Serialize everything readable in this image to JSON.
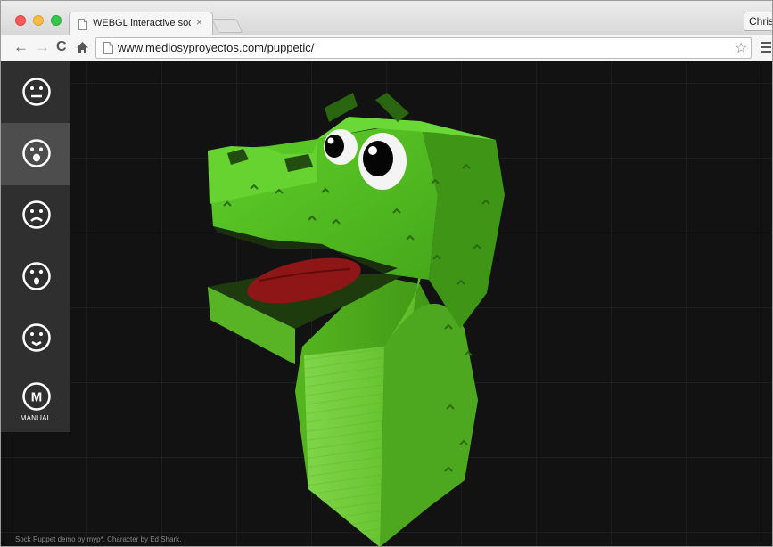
{
  "browser": {
    "tab_title": "WEBGL interactive sock pu",
    "tab_close": "×",
    "profile_name": "Chris",
    "url": "www.mediosyproyectos.com/puppetic/",
    "nav": {
      "back": "←",
      "forward": "→",
      "reload": "C",
      "star": "☆"
    }
  },
  "sidebar": {
    "buttons": [
      {
        "icon": "neutral-face-icon"
      },
      {
        "icon": "surprised-face-icon",
        "active": true
      },
      {
        "icon": "sad-face-icon"
      },
      {
        "icon": "shocked-face-icon"
      },
      {
        "icon": "worried-face-icon"
      },
      {
        "icon": "manual-mode-icon",
        "letter": "M",
        "label": "MANUAL"
      }
    ]
  },
  "scene": {
    "subject": "green-sock-puppet",
    "colors": {
      "background": "#121212",
      "puppet_green": "#5fcc26",
      "puppet_dark": "#2f7310",
      "tongue": "#8f1616",
      "sidebar": "#2f2f2f",
      "sidebar_active": "#4d4d4d"
    }
  },
  "footer": {
    "prefix": "Sock Puppet demo by ",
    "credit_link": "myp*",
    "middle": ". Character by ",
    "character_link": "Ed Shark",
    "suffix": "."
  }
}
